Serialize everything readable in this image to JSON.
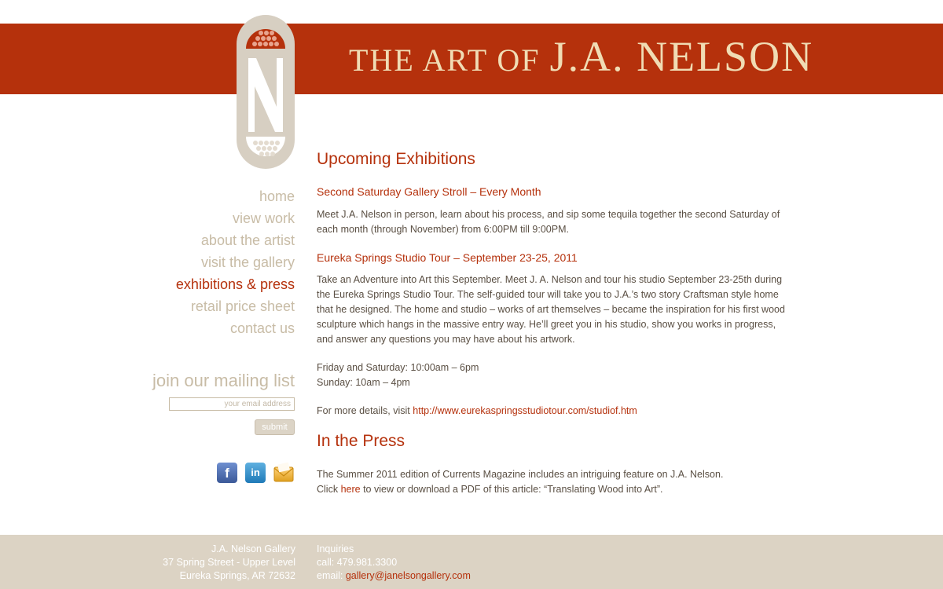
{
  "header": {
    "title_lead": "THE ART OF",
    "title_name": "J.A. NELSON"
  },
  "nav": {
    "items": [
      {
        "label": "home",
        "active": false
      },
      {
        "label": "view work",
        "active": false
      },
      {
        "label": "about the artist",
        "active": false
      },
      {
        "label": "visit the gallery",
        "active": false
      },
      {
        "label": "exhibitions & press",
        "active": true
      },
      {
        "label": "retail price sheet",
        "active": false
      },
      {
        "label": "contact us",
        "active": false
      }
    ]
  },
  "mailing": {
    "heading": "join our mailing list",
    "placeholder": "your email address",
    "submit_label": "submit"
  },
  "social": {
    "facebook_glyph": "f",
    "linkedin_glyph": "in"
  },
  "main": {
    "upcoming_heading": "Upcoming Exhibitions",
    "event1_title": "Second Saturday Gallery Stroll – Every Month",
    "event1_body": "Meet J.A. Nelson in person, learn about his process, and sip some tequila together the second Saturday of each month (through November) from 6:00PM till 9:00PM.",
    "event2_title": "Eureka Springs Studio Tour – September 23-25, 2011",
    "event2_body": "Take an Adventure into Art this September. Meet J. A. Nelson and tour his studio September 23-25th during the Eureka Springs Studio Tour. The self-guided tour will take you to J.A.’s two story Craftsman style home that he designed. The home and studio – works of art themselves – became the inspiration for his first wood sculpture which hangs in the massive entry way. He’ll greet you in his studio, show you works in progress, and answer any questions you may have about his artwork.",
    "hours_line1": "Friday and Saturday: 10:00am – 6pm",
    "hours_line2": "Sunday: 10am – 4pm",
    "details_prefix": "For more details, visit ",
    "details_link": "http://www.eurekaspringsstudiotour.com/studiof.htm",
    "press_heading": "In the Press",
    "press_line1": "The Summer 2011 edition of Currents Magazine includes an intriguing feature on J.A. Nelson.",
    "press_click": "Click ",
    "press_here": "here",
    "press_rest": " to view or download a PDF of this article: “Translating Wood into Art”."
  },
  "footer": {
    "gallery_name": "J.A. Nelson Gallery",
    "address_line1": "37 Spring Street - Upper Level",
    "address_line2": "Eureka Springs, AR 72632",
    "inquiries_label": "Inquiries",
    "phone": "call: 479.981.3300",
    "email_prefix": "email: ",
    "email": "gallery@janelsongallery.com"
  },
  "colors": {
    "brand_red": "#b5310c",
    "title_cream": "#f0dcb4",
    "nav_tan": "#c8bca6",
    "footer_tan": "#dcd3c4"
  }
}
